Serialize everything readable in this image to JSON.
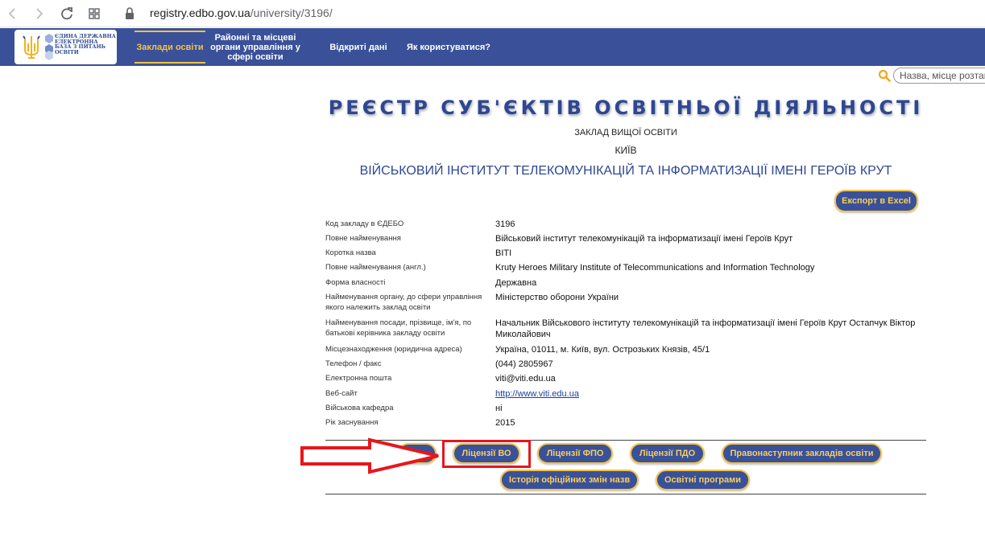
{
  "browser": {
    "url_domain": "registry.edbo.gov.ua",
    "url_path": "/university/3196/"
  },
  "header": {
    "logo_text": "ЄДИНА ДЕРЖАВНА ЕЛЕКТРОННА БАЗА З ПИТАНЬ ОСВІТИ",
    "menu": [
      {
        "label": "Заклади освіти",
        "active": true
      },
      {
        "label": "Районні та місцеві органи управління у сфері освіти",
        "active": false
      },
      {
        "label": "Відкриті дані",
        "active": false
      },
      {
        "label": "Як користуватися?",
        "active": false
      }
    ]
  },
  "search": {
    "placeholder": "Назва, місце розташування"
  },
  "page": {
    "registry_title": "РЕЄСТР СУБ'ЄКТІВ ОСВІТНЬОЇ ДІЯЛЬНОСТІ",
    "institution_type": "ЗАКЛАД ВИЩОЇ ОСВІТИ",
    "city": "КИЇВ",
    "institution_name": "ВІЙСЬКОВИЙ ІНСТИТУТ ТЕЛЕКОМУНІКАЦІЙ ТА ІНФОРМАТИЗАЦІЇ ІМЕНІ ГЕРОЇВ КРУТ",
    "export_label": "Експорт в Excel"
  },
  "info_rows": [
    {
      "label": "Код закладу в ЄДЕБО",
      "value": "3196"
    },
    {
      "label": "Повне найменування",
      "value": "Військовий інститут телекомунікацій та інформатизації імені Героїв Крут"
    },
    {
      "label": "Коротка назва",
      "value": "ВІТІ"
    },
    {
      "label": "Повне найменування (англ.)",
      "value": "Kruty Heroes Military Institute of Telecommunications and Information Technology"
    },
    {
      "label": "Форма власності",
      "value": "Державна"
    },
    {
      "label": "Найменування органу, до сфери управління якого належить заклад освіти",
      "value": "Міністерство оборони України"
    },
    {
      "label": "Найменування посади, прізвище, ім'я, по батькові керівника закладу освіти",
      "value": "Начальник Військового інституту телекомунікацій та інформатизації імені Героїв Крут Остапчук Віктор Миколайович"
    },
    {
      "label": "Місцезнаходження (юридична адреса)",
      "value": "Україна, 01011, м. Київ, вул. Острозьких Князів, 45/1"
    },
    {
      "label": "Телефон / факс",
      "value": "(044) 2805967"
    },
    {
      "label": "Електронна пошта",
      "value": "viti@viti.edu.ua"
    },
    {
      "label": "Веб-сайт",
      "value": "http://www.viti.edu.ua"
    },
    {
      "label": "Військова кафедра",
      "value": "ні"
    },
    {
      "label": "Рік заснування",
      "value": "2015"
    }
  ],
  "tab_buttons": {
    "licenses_vo": "Ліцензії ВО",
    "licenses_fpo": "Ліцензії ФПО",
    "licenses_pdo": "Ліцензії ПДО",
    "successor": "Правонаступник закладів освіти",
    "name_history": "Історія офіційних змін назв",
    "programs": "Освітні програми"
  },
  "colors": {
    "header_bg": "#3a5199",
    "accent_gold": "#f5c242",
    "title_blue": "#2d4792",
    "annotation_red": "#e5171c"
  }
}
